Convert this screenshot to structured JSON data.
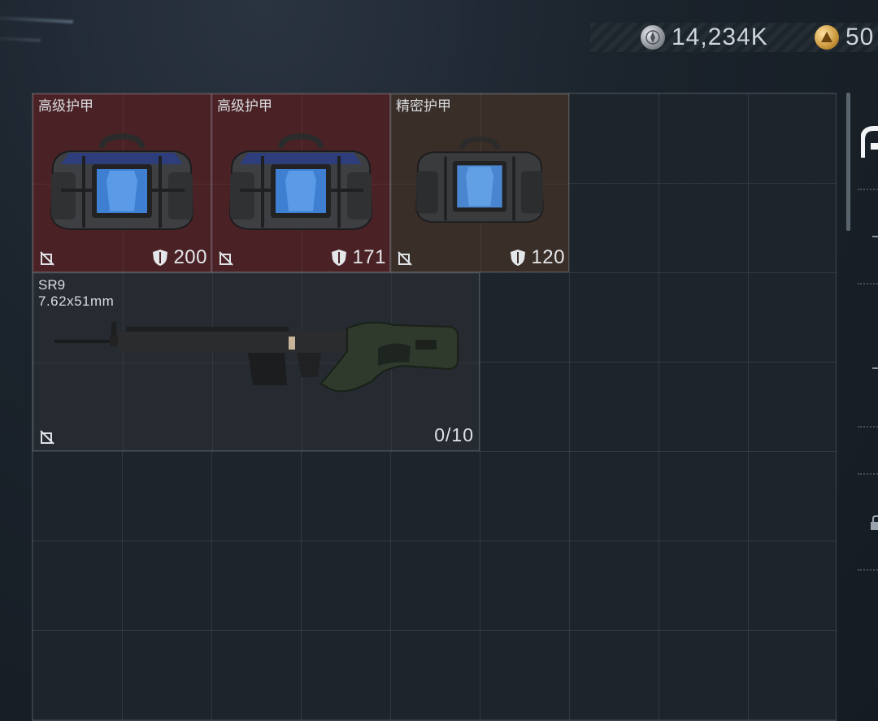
{
  "currency": {
    "silver": {
      "icon": "silver-coin-icon",
      "value": "14,234K"
    },
    "gold": {
      "icon": "gold-coin-icon",
      "value": "50"
    }
  },
  "inventory": {
    "items": [
      {
        "name": "高级护甲",
        "type": "armor-bag",
        "rarity_color": "#4a2226",
        "armor_value": "200"
      },
      {
        "name": "高级护甲",
        "type": "armor-bag",
        "rarity_color": "#4a2226",
        "armor_value": "171"
      },
      {
        "name": "精密护甲",
        "type": "armor-bag",
        "rarity_color": "#3a2e28",
        "armor_value": "120"
      },
      {
        "name": "SR9",
        "subtitle": "7.62x51mm",
        "type": "rifle",
        "ammo": "0/10"
      }
    ]
  }
}
